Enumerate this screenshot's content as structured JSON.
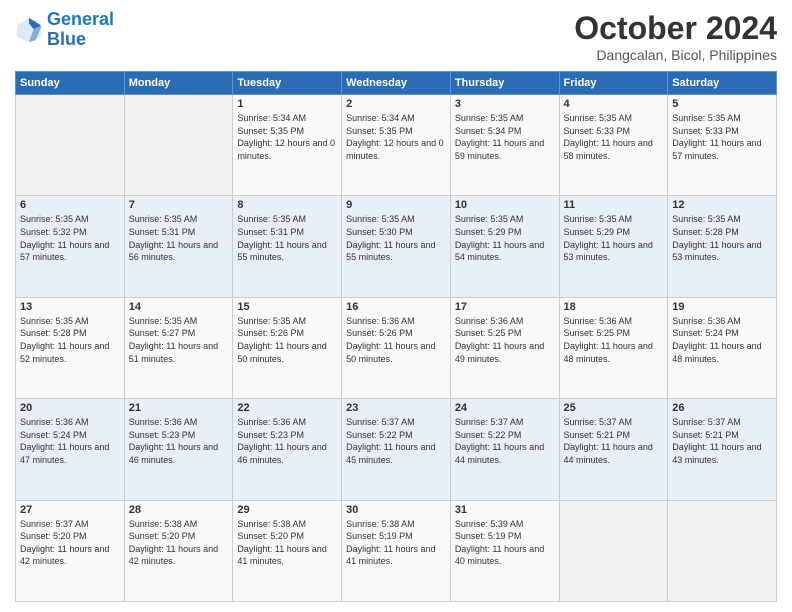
{
  "header": {
    "logo_line1": "General",
    "logo_line2": "Blue",
    "month": "October 2024",
    "location": "Dangcalan, Bicol, Philippines"
  },
  "days_of_week": [
    "Sunday",
    "Monday",
    "Tuesday",
    "Wednesday",
    "Thursday",
    "Friday",
    "Saturday"
  ],
  "weeks": [
    [
      {
        "day": "",
        "sunrise": "",
        "sunset": "",
        "daylight": ""
      },
      {
        "day": "",
        "sunrise": "",
        "sunset": "",
        "daylight": ""
      },
      {
        "day": "1",
        "sunrise": "Sunrise: 5:34 AM",
        "sunset": "Sunset: 5:35 PM",
        "daylight": "Daylight: 12 hours and 0 minutes."
      },
      {
        "day": "2",
        "sunrise": "Sunrise: 5:34 AM",
        "sunset": "Sunset: 5:35 PM",
        "daylight": "Daylight: 12 hours and 0 minutes."
      },
      {
        "day": "3",
        "sunrise": "Sunrise: 5:35 AM",
        "sunset": "Sunset: 5:34 PM",
        "daylight": "Daylight: 11 hours and 59 minutes."
      },
      {
        "day": "4",
        "sunrise": "Sunrise: 5:35 AM",
        "sunset": "Sunset: 5:33 PM",
        "daylight": "Daylight: 11 hours and 58 minutes."
      },
      {
        "day": "5",
        "sunrise": "Sunrise: 5:35 AM",
        "sunset": "Sunset: 5:33 PM",
        "daylight": "Daylight: 11 hours and 57 minutes."
      }
    ],
    [
      {
        "day": "6",
        "sunrise": "Sunrise: 5:35 AM",
        "sunset": "Sunset: 5:32 PM",
        "daylight": "Daylight: 11 hours and 57 minutes."
      },
      {
        "day": "7",
        "sunrise": "Sunrise: 5:35 AM",
        "sunset": "Sunset: 5:31 PM",
        "daylight": "Daylight: 11 hours and 56 minutes."
      },
      {
        "day": "8",
        "sunrise": "Sunrise: 5:35 AM",
        "sunset": "Sunset: 5:31 PM",
        "daylight": "Daylight: 11 hours and 55 minutes."
      },
      {
        "day": "9",
        "sunrise": "Sunrise: 5:35 AM",
        "sunset": "Sunset: 5:30 PM",
        "daylight": "Daylight: 11 hours and 55 minutes."
      },
      {
        "day": "10",
        "sunrise": "Sunrise: 5:35 AM",
        "sunset": "Sunset: 5:29 PM",
        "daylight": "Daylight: 11 hours and 54 minutes."
      },
      {
        "day": "11",
        "sunrise": "Sunrise: 5:35 AM",
        "sunset": "Sunset: 5:29 PM",
        "daylight": "Daylight: 11 hours and 53 minutes."
      },
      {
        "day": "12",
        "sunrise": "Sunrise: 5:35 AM",
        "sunset": "Sunset: 5:28 PM",
        "daylight": "Daylight: 11 hours and 53 minutes."
      }
    ],
    [
      {
        "day": "13",
        "sunrise": "Sunrise: 5:35 AM",
        "sunset": "Sunset: 5:28 PM",
        "daylight": "Daylight: 11 hours and 52 minutes."
      },
      {
        "day": "14",
        "sunrise": "Sunrise: 5:35 AM",
        "sunset": "Sunset: 5:27 PM",
        "daylight": "Daylight: 11 hours and 51 minutes."
      },
      {
        "day": "15",
        "sunrise": "Sunrise: 5:35 AM",
        "sunset": "Sunset: 5:26 PM",
        "daylight": "Daylight: 11 hours and 50 minutes."
      },
      {
        "day": "16",
        "sunrise": "Sunrise: 5:36 AM",
        "sunset": "Sunset: 5:26 PM",
        "daylight": "Daylight: 11 hours and 50 minutes."
      },
      {
        "day": "17",
        "sunrise": "Sunrise: 5:36 AM",
        "sunset": "Sunset: 5:25 PM",
        "daylight": "Daylight: 11 hours and 49 minutes."
      },
      {
        "day": "18",
        "sunrise": "Sunrise: 5:36 AM",
        "sunset": "Sunset: 5:25 PM",
        "daylight": "Daylight: 11 hours and 48 minutes."
      },
      {
        "day": "19",
        "sunrise": "Sunrise: 5:36 AM",
        "sunset": "Sunset: 5:24 PM",
        "daylight": "Daylight: 11 hours and 48 minutes."
      }
    ],
    [
      {
        "day": "20",
        "sunrise": "Sunrise: 5:36 AM",
        "sunset": "Sunset: 5:24 PM",
        "daylight": "Daylight: 11 hours and 47 minutes."
      },
      {
        "day": "21",
        "sunrise": "Sunrise: 5:36 AM",
        "sunset": "Sunset: 5:23 PM",
        "daylight": "Daylight: 11 hours and 46 minutes."
      },
      {
        "day": "22",
        "sunrise": "Sunrise: 5:36 AM",
        "sunset": "Sunset: 5:23 PM",
        "daylight": "Daylight: 11 hours and 46 minutes."
      },
      {
        "day": "23",
        "sunrise": "Sunrise: 5:37 AM",
        "sunset": "Sunset: 5:22 PM",
        "daylight": "Daylight: 11 hours and 45 minutes."
      },
      {
        "day": "24",
        "sunrise": "Sunrise: 5:37 AM",
        "sunset": "Sunset: 5:22 PM",
        "daylight": "Daylight: 11 hours and 44 minutes."
      },
      {
        "day": "25",
        "sunrise": "Sunrise: 5:37 AM",
        "sunset": "Sunset: 5:21 PM",
        "daylight": "Daylight: 11 hours and 44 minutes."
      },
      {
        "day": "26",
        "sunrise": "Sunrise: 5:37 AM",
        "sunset": "Sunset: 5:21 PM",
        "daylight": "Daylight: 11 hours and 43 minutes."
      }
    ],
    [
      {
        "day": "27",
        "sunrise": "Sunrise: 5:37 AM",
        "sunset": "Sunset: 5:20 PM",
        "daylight": "Daylight: 11 hours and 42 minutes."
      },
      {
        "day": "28",
        "sunrise": "Sunrise: 5:38 AM",
        "sunset": "Sunset: 5:20 PM",
        "daylight": "Daylight: 11 hours and 42 minutes."
      },
      {
        "day": "29",
        "sunrise": "Sunrise: 5:38 AM",
        "sunset": "Sunset: 5:20 PM",
        "daylight": "Daylight: 11 hours and 41 minutes."
      },
      {
        "day": "30",
        "sunrise": "Sunrise: 5:38 AM",
        "sunset": "Sunset: 5:19 PM",
        "daylight": "Daylight: 11 hours and 41 minutes."
      },
      {
        "day": "31",
        "sunrise": "Sunrise: 5:39 AM",
        "sunset": "Sunset: 5:19 PM",
        "daylight": "Daylight: 11 hours and 40 minutes."
      },
      {
        "day": "",
        "sunrise": "",
        "sunset": "",
        "daylight": ""
      },
      {
        "day": "",
        "sunrise": "",
        "sunset": "",
        "daylight": ""
      }
    ]
  ]
}
